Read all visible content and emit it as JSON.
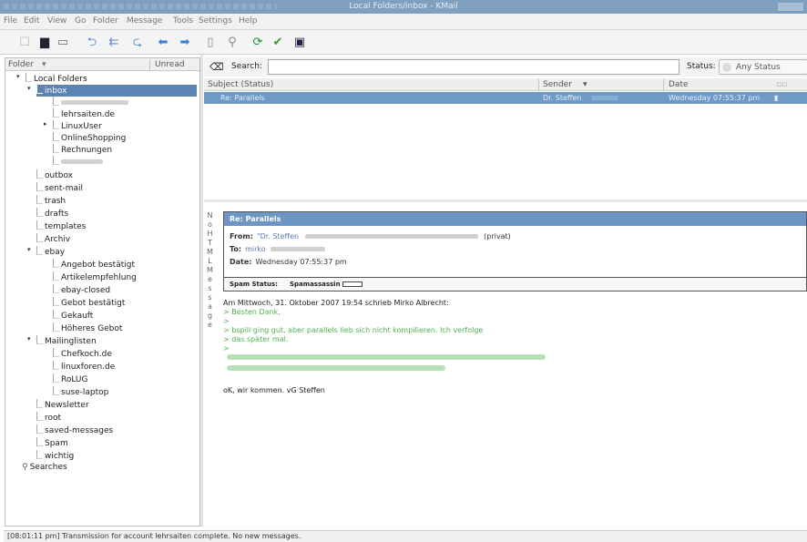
{
  "window": {
    "title": "Local Folders/inbox - KMail"
  },
  "menu": [
    "File",
    "Edit",
    "View",
    "Go",
    "Folder",
    "Message",
    "Tools",
    "Settings",
    "Help"
  ],
  "toolbar": {
    "icons": [
      "new-mail-icon",
      "save-icon",
      "print-icon",
      "reply-icon",
      "reply-all-icon",
      "forward-icon",
      "previous-icon",
      "next-icon",
      "clipboard-icon",
      "find-icon",
      "check-mail-icon",
      "spam-icon",
      "addressbook-icon"
    ]
  },
  "folder_pane": {
    "col_folder": "Folder",
    "col_unread": "Unread",
    "tree": [
      {
        "label": "Local Folders",
        "expander": "▾"
      },
      {
        "label": "inbox",
        "expander": "▾",
        "selected": true
      },
      {
        "label": "",
        "blurred": true
      },
      {
        "label": "lehrsaiten.de"
      },
      {
        "label": "LinuxUser",
        "expander": "▸"
      },
      {
        "label": "OnlineShopping"
      },
      {
        "label": "Rechnungen"
      },
      {
        "label": "",
        "blurred": true
      },
      {
        "label": "outbox"
      },
      {
        "label": "sent-mail"
      },
      {
        "label": "trash"
      },
      {
        "label": "drafts"
      },
      {
        "label": "templates"
      },
      {
        "label": "Archiv"
      },
      {
        "label": "ebay",
        "expander": "▾"
      },
      {
        "label": "Angebot bestätigt"
      },
      {
        "label": "Artikelempfehlung"
      },
      {
        "label": "ebay-closed"
      },
      {
        "label": "Gebot bestätigt"
      },
      {
        "label": "Gekauft"
      },
      {
        "label": "Höheres Gebot"
      },
      {
        "label": "Mailinglisten",
        "expander": "▾"
      },
      {
        "label": "Chefkoch.de"
      },
      {
        "label": "linuxforen.de"
      },
      {
        "label": "RoLUG"
      },
      {
        "label": "suse-laptop"
      },
      {
        "label": "Newsletter"
      },
      {
        "label": "root"
      },
      {
        "label": "saved-messages"
      },
      {
        "label": "Spam"
      },
      {
        "label": "wichtig"
      },
      {
        "label": "Searches"
      }
    ]
  },
  "search": {
    "label": "Search:",
    "value": "",
    "status_label": "Status:",
    "status_value": "Any Status"
  },
  "message_list": {
    "columns": {
      "subject": "Subject (Status)",
      "sender": "Sender",
      "date": "Date"
    },
    "rows": [
      {
        "subject": "Re: Parallels",
        "sender": "Dr. Steffen",
        "date": "Wednesday 07:55:37 pm"
      }
    ]
  },
  "reader": {
    "side_letters": [
      "N",
      "o",
      "",
      "H",
      "T",
      "M",
      "L",
      "",
      "M",
      "e",
      "s",
      "s",
      "a",
      "g",
      "e"
    ],
    "subject": "Re: Parallels",
    "from_label": "From:",
    "from_value": "\"Dr. Steffen",
    "from_suffix": "(privat)",
    "to_label": "To:",
    "to_value": "mirko",
    "date_label": "Date:",
    "date_value": "Wednesday 07:55:37 pm",
    "spam_label": "Spam Status:",
    "spam_value": "Spamassassin",
    "body": {
      "intro": "Am Mittwoch, 31. Oktober 2007 19:54 schrieb Mirko Albrecht:",
      "q1": "> Besten Dank,",
      "q2": ">",
      "q3": "> bspill ging gut, aber parallels lieb sich nicht kompilieren. Ich verfolge",
      "q4": "> das später mal.",
      "q5": ">",
      "signoff": "oK, wir kommen. vG Steffen"
    }
  },
  "status_bar": {
    "text": "[08:01:11 pm] Transmission for account lehrsaiten complete. No new messages."
  }
}
